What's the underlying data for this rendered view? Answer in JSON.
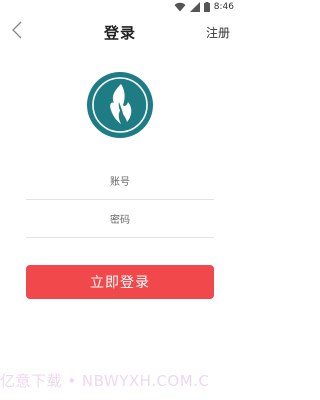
{
  "status_bar": {
    "time": "8:46",
    "icons": [
      "wifi-icon",
      "signal-icon",
      "battery-icon"
    ]
  },
  "header": {
    "back_icon": "chevron-left-icon",
    "title": "登录",
    "register_label": "注册"
  },
  "logo": {
    "icon": "flame-logo",
    "colors": {
      "ring": "#1e7d84",
      "flame": "#ffffff"
    }
  },
  "form": {
    "account_placeholder": "账号",
    "account_value": "",
    "password_placeholder": "密码",
    "password_value": "",
    "login_label": "立即登录"
  },
  "colors": {
    "accent": "#f0484b",
    "logo_teal": "#1e7d84"
  },
  "watermark": "亿意下载 • NBWYXH.COM.C"
}
